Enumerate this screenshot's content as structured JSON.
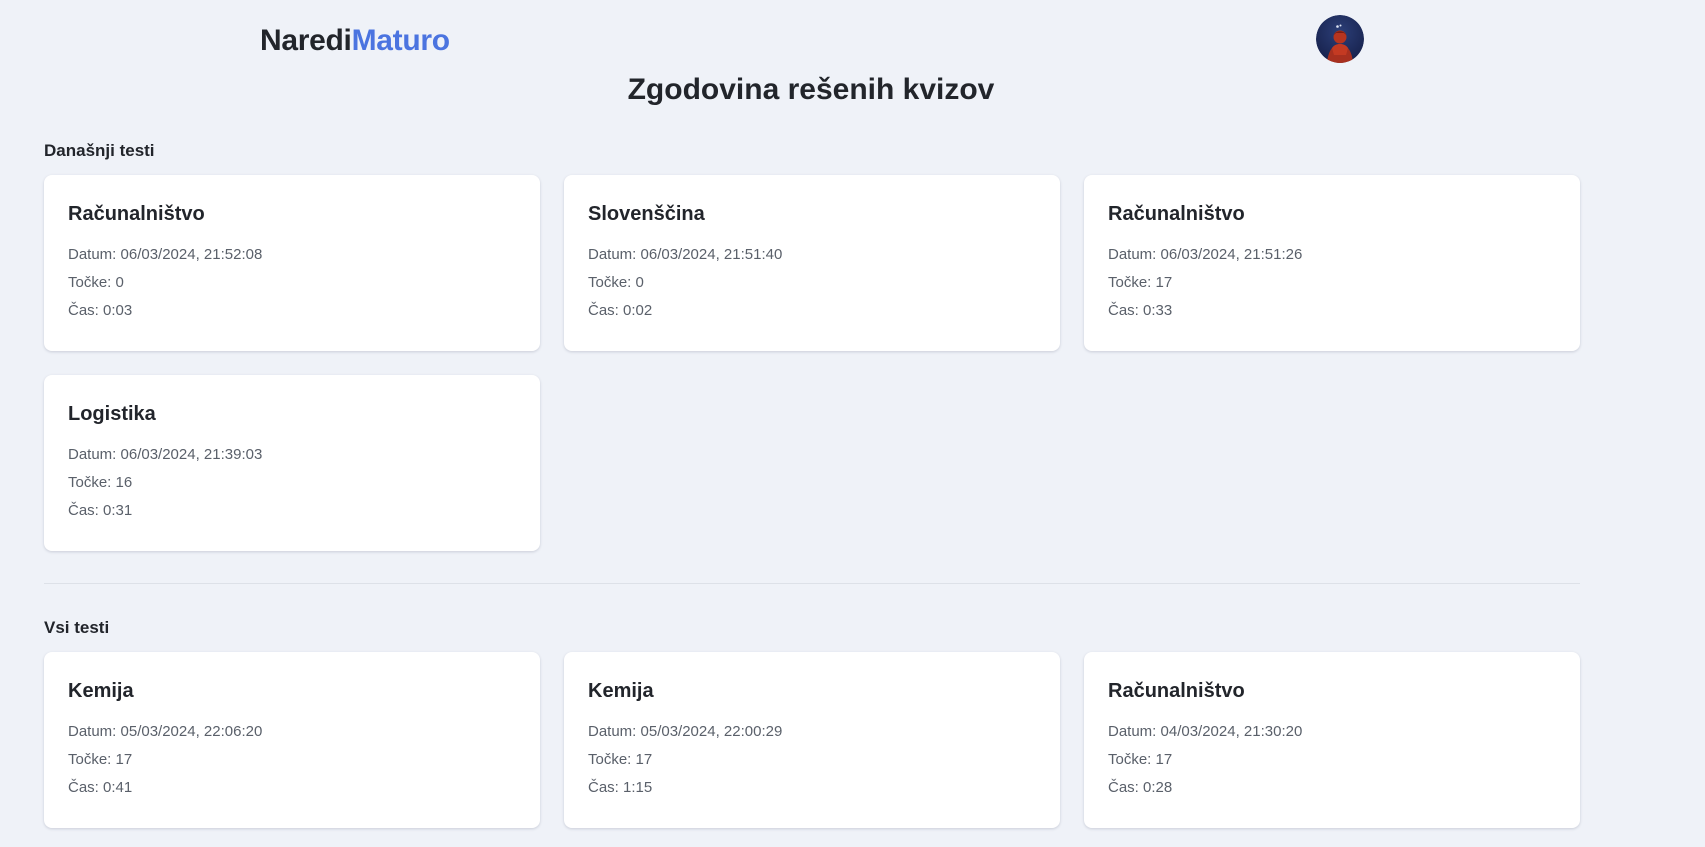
{
  "brand": {
    "name_part1": "Naredi",
    "name_part2": "Maturo"
  },
  "page": {
    "title": "Zgodovina rešenih kvizov"
  },
  "labels": {
    "date": "Datum: ",
    "points": "Točke: ",
    "time": "Čas: "
  },
  "sections": [
    {
      "title": "Današnji testi",
      "quizzes": [
        {
          "subject": "Računalništvo",
          "date": "06/03/2024, 21:52:08",
          "points": "0",
          "time": "0:03"
        },
        {
          "subject": "Slovenščina",
          "date": "06/03/2024, 21:51:40",
          "points": "0",
          "time": "0:02"
        },
        {
          "subject": "Računalništvo",
          "date": "06/03/2024, 21:51:26",
          "points": "17",
          "time": "0:33"
        },
        {
          "subject": "Logistika",
          "date": "06/03/2024, 21:39:03",
          "points": "16",
          "time": "0:31"
        }
      ]
    },
    {
      "title": "Vsi testi",
      "quizzes": [
        {
          "subject": "Kemija",
          "date": "05/03/2024, 22:06:20",
          "points": "17",
          "time": "0:41"
        },
        {
          "subject": "Kemija",
          "date": "05/03/2024, 22:00:29",
          "points": "17",
          "time": "1:15"
        },
        {
          "subject": "Računalništvo",
          "date": "04/03/2024, 21:30:20",
          "points": "17",
          "time": "0:28"
        }
      ]
    }
  ],
  "colors": {
    "background": "#eff2f8",
    "brand_accent": "#4b74e0",
    "card": "#ffffff",
    "text_primary": "#22252b",
    "text_secondary": "#5a606a"
  }
}
